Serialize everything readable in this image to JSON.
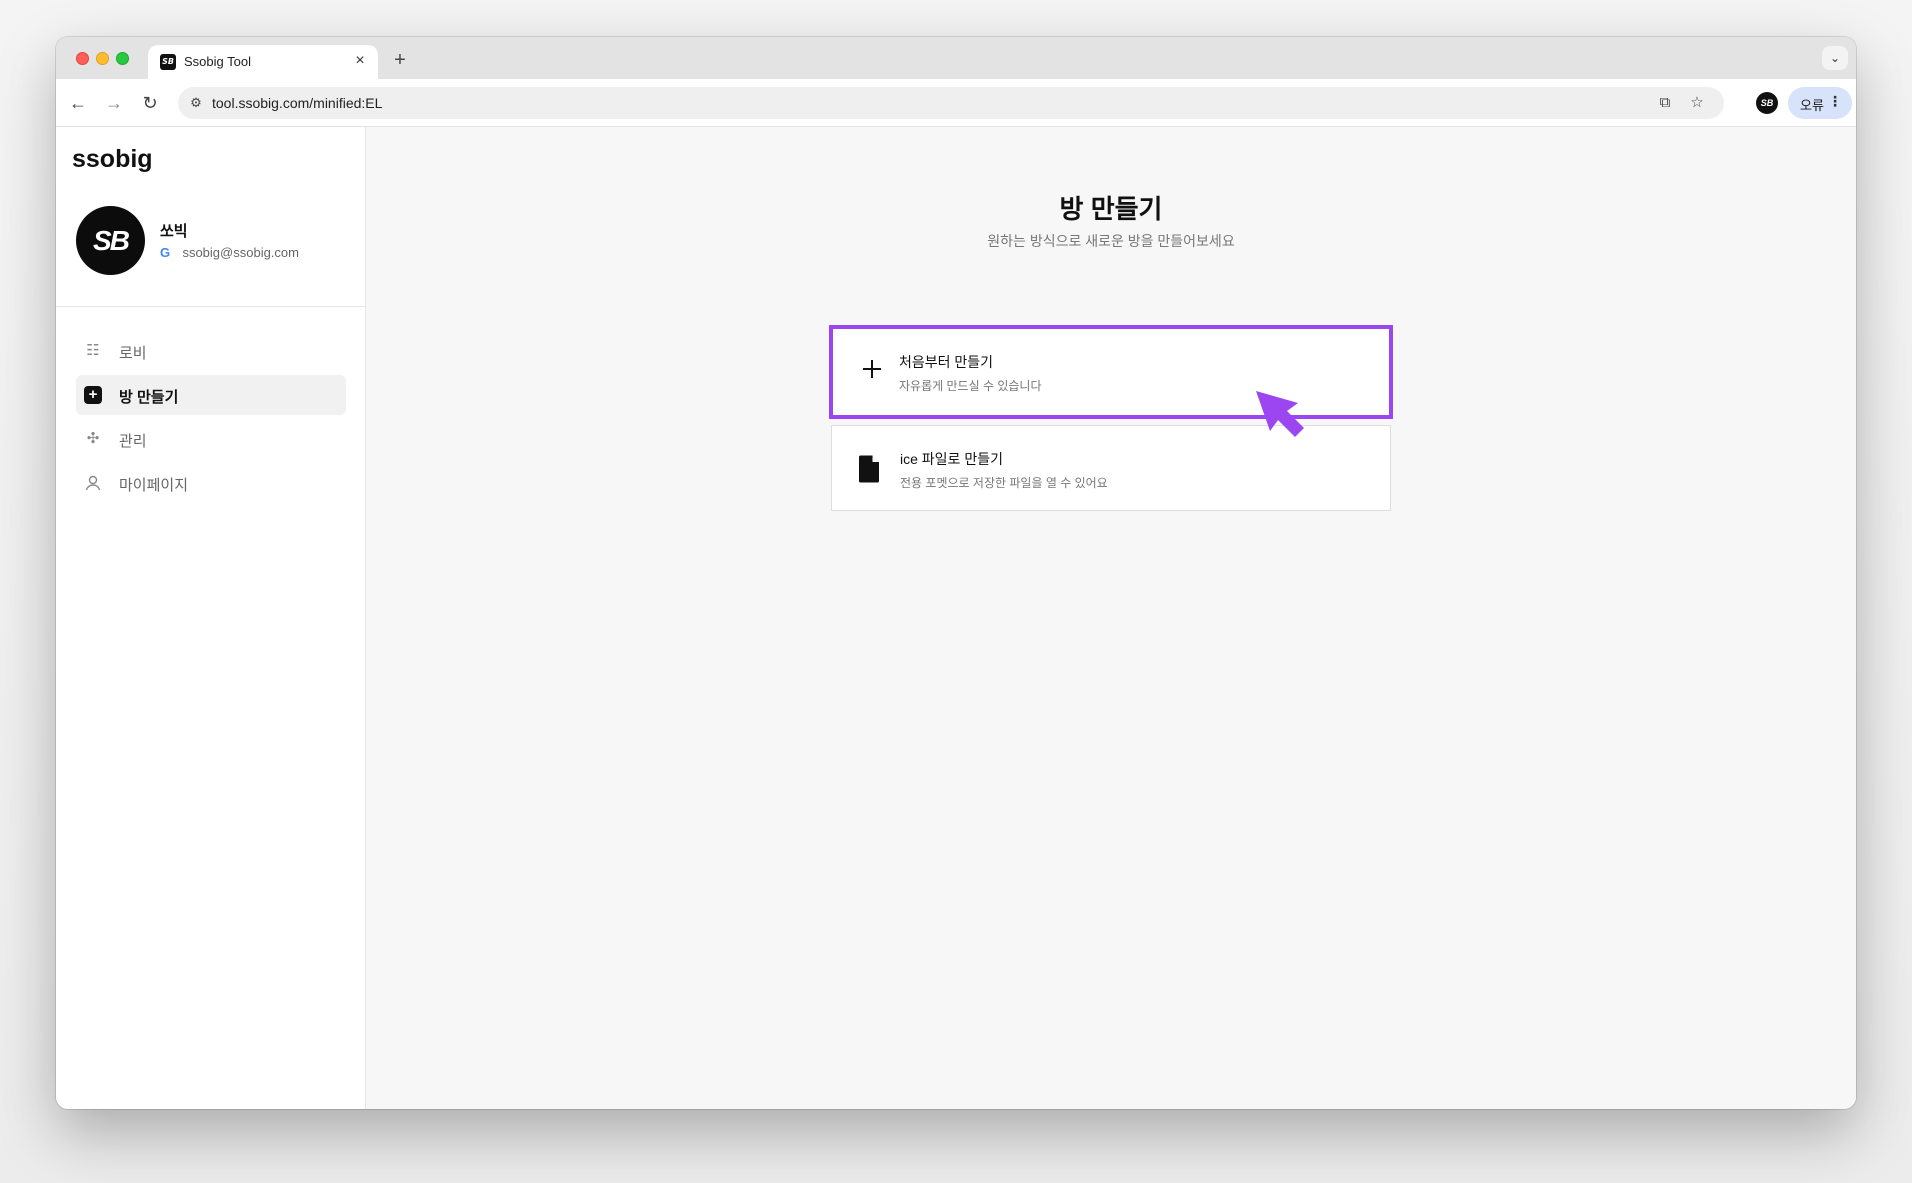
{
  "browser": {
    "tab_title": "Ssobig Tool",
    "tab_close": "×",
    "new_tab": "+",
    "url": "tool.ssobig.com/minified:EL",
    "profile_label": "오류"
  },
  "sidebar": {
    "brand": "ssobig",
    "user": {
      "name": "쏘빅",
      "email": "ssobig@ssobig.com"
    },
    "items": [
      {
        "label": "로비",
        "active": false
      },
      {
        "label": "방 만들기",
        "active": true
      },
      {
        "label": "관리",
        "active": false
      },
      {
        "label": "마이페이지",
        "active": false
      }
    ]
  },
  "main": {
    "title": "방 만들기",
    "subtitle": "원하는 방식으로 새로운 방을 만들어보세요",
    "options": [
      {
        "title": "처음부터 만들기",
        "description": "자유롭게 만드실 수 있습니다",
        "icon": "plus-icon",
        "highlighted": true
      },
      {
        "title": "ice 파일로 만들기",
        "description": "전용 포멧으로 저장한 파일을 열 수 있어요",
        "icon": "file-icon",
        "highlighted": false
      }
    ]
  },
  "colors": {
    "highlight": "#9b46f0",
    "active_nav_bg": "#f1f1f1",
    "main_bg": "#f7f7f7"
  }
}
